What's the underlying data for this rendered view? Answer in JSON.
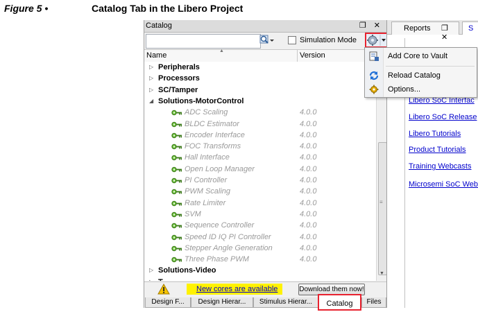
{
  "caption": {
    "figure": "Figure 5 •",
    "title": "Catalog Tab in the Libero Project"
  },
  "catalog_panel": {
    "title": "Catalog",
    "header_buttons": "❐ ✕",
    "search": {
      "value": "",
      "placeholder": ""
    },
    "simulation_mode": {
      "label": "Simulation Mode",
      "checked": false
    },
    "columns": {
      "name": "Name",
      "version": "Version"
    },
    "tree": [
      {
        "kind": "group",
        "label": "Peripherals",
        "expanded": false
      },
      {
        "kind": "group",
        "label": "Processors",
        "expanded": false
      },
      {
        "kind": "group",
        "label": "SC/Tamper",
        "expanded": false
      },
      {
        "kind": "group",
        "label": "Solutions-MotorControl",
        "expanded": true
      },
      {
        "kind": "item",
        "label": "ADC Scaling",
        "version": "4.0.0"
      },
      {
        "kind": "item",
        "label": "BLDC Estimator",
        "version": "4.0.0"
      },
      {
        "kind": "item",
        "label": "Encoder Interface",
        "version": "4.0.0"
      },
      {
        "kind": "item",
        "label": "FOC Transforms",
        "version": "4.0.0"
      },
      {
        "kind": "item",
        "label": "Hall Interface",
        "version": "4.0.0"
      },
      {
        "kind": "item",
        "label": "Open Loop Manager",
        "version": "4.0.0"
      },
      {
        "kind": "item",
        "label": "PI Controller",
        "version": "4.0.0"
      },
      {
        "kind": "item",
        "label": "PWM Scaling",
        "version": "4.0.0"
      },
      {
        "kind": "item",
        "label": "Rate Limiter",
        "version": "4.0.0"
      },
      {
        "kind": "item",
        "label": "SVM",
        "version": "4.0.0"
      },
      {
        "kind": "item",
        "label": "Sequence Controller",
        "version": "4.0.0"
      },
      {
        "kind": "item",
        "label": "Speed ID IQ PI Controller",
        "version": "4.0.0"
      },
      {
        "kind": "item",
        "label": "Stepper Angle Generation",
        "version": "4.0.0"
      },
      {
        "kind": "item",
        "label": "Three Phase PWM",
        "version": "4.0.0"
      },
      {
        "kind": "group",
        "label": "Solutions-Video",
        "expanded": false
      },
      {
        "kind": "group",
        "label": "T...",
        "expanded": false
      }
    ],
    "notice": {
      "link": "New cores are available",
      "button": "Download them now!"
    },
    "bottom_tabs": [
      {
        "label": "Design F...",
        "active": false
      },
      {
        "label": "Design Hierar...",
        "active": false
      },
      {
        "label": "Stimulus Hierar...",
        "active": false
      },
      {
        "label": "Catalog",
        "active": true
      },
      {
        "label": "Files",
        "active": false
      }
    ]
  },
  "right_pane": {
    "tab_reports": "Reports",
    "tab_reports_buttons": "❐ ✕",
    "tab_start_partial": "S",
    "links": [
      "Libero SoC Interfac",
      "Libero SoC Release",
      "Libero Tutorials",
      "Product Tutorials",
      "Training Webcasts",
      "Microsemi SoC Web"
    ]
  },
  "gear_menu": {
    "items": [
      {
        "label": "Add Core to Vault",
        "icon": "add-core-icon"
      },
      {
        "label": "Reload Catalog",
        "icon": "reload-icon"
      },
      {
        "label": "Options...",
        "icon": "options-gear-icon"
      }
    ]
  },
  "colors": {
    "highlight_red": "#e8222f",
    "link_blue": "#0000cc",
    "notice_yellow": "#fff200",
    "disabled_gray": "#9a9a9a"
  }
}
